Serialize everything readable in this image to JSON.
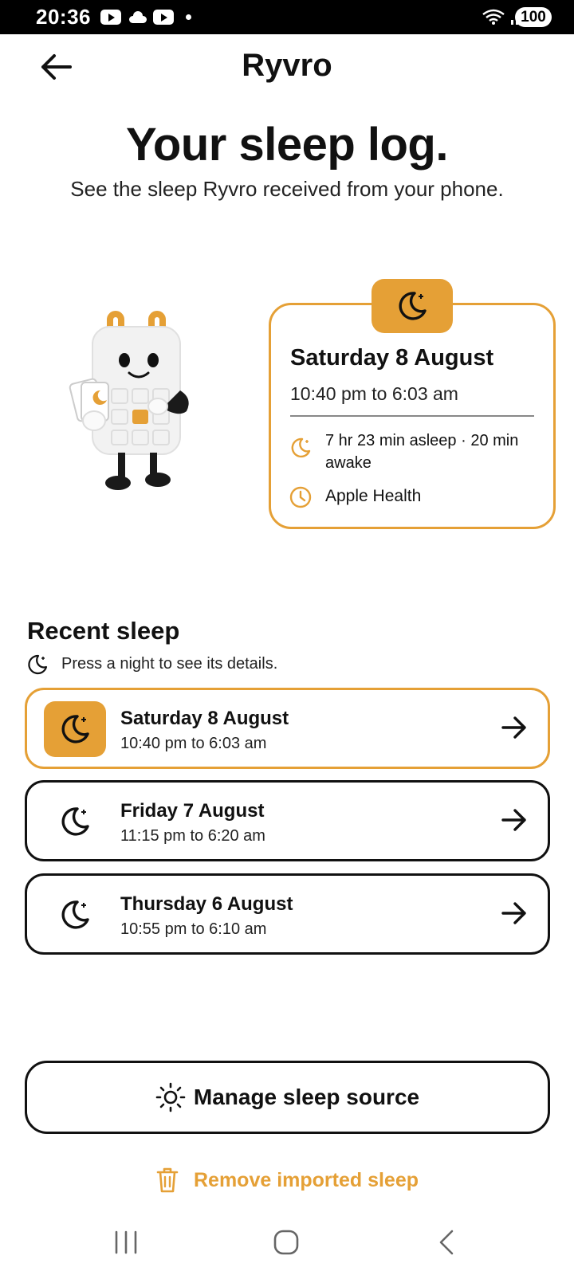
{
  "status_bar": {
    "time": "20:36",
    "battery": "100"
  },
  "header": {
    "title": "Ryvro",
    "back_icon": "arrow-left-icon"
  },
  "hero": {
    "headline": "Your sleep log.",
    "subtitle": "See the sleep Ryvro received from your phone."
  },
  "detail_card": {
    "date": "Saturday 8 August",
    "time_range": "10:40 pm to 6:03 am",
    "summary": "7 hr 23 min asleep · 20 min awake",
    "source": "Apple Health"
  },
  "recent": {
    "title": "Recent sleep",
    "hint": "Press a night to see its details.",
    "items": [
      {
        "date": "Saturday 8 August",
        "time_range": "10:40 pm to 6:03 am",
        "selected": true
      },
      {
        "date": "Friday 7 August",
        "time_range": "11:15 pm to 6:20 am",
        "selected": false
      },
      {
        "date": "Thursday 6 August",
        "time_range": "10:55 pm to 6:10 am",
        "selected": false
      }
    ]
  },
  "actions": {
    "manage_label": "Manage sleep source",
    "remove_label": "Remove imported sleep"
  },
  "colors": {
    "accent": "#e5a036",
    "text": "#111111",
    "background": "#ffffff"
  }
}
